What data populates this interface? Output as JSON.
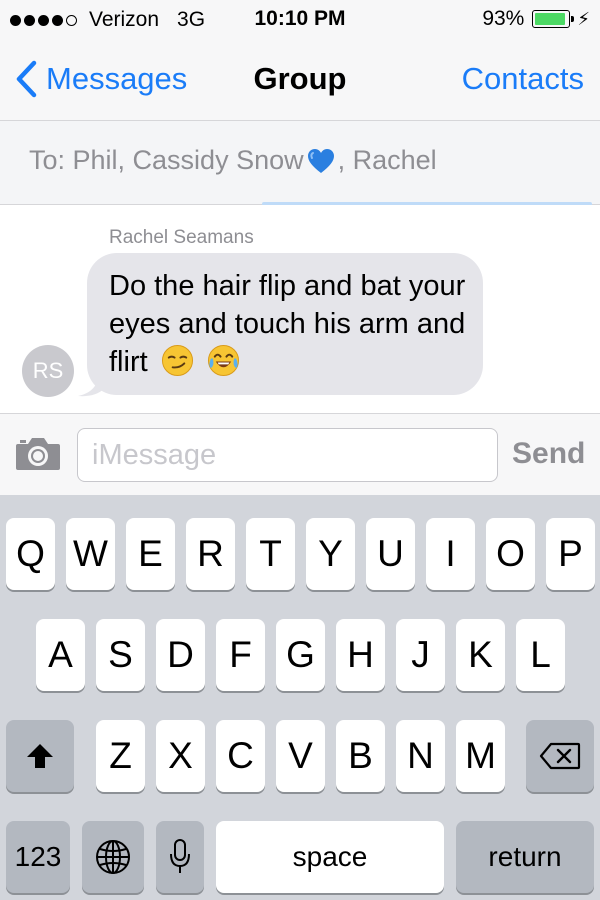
{
  "status_bar": {
    "carrier": "Verizon",
    "network": "3G",
    "time": "10:10 PM",
    "battery_percent": "93%",
    "battery_level": 0.93,
    "signal_bars_filled": 4,
    "signal_bars_total": 5
  },
  "nav": {
    "back_label": "Messages",
    "title": "Group",
    "contacts_label": "Contacts"
  },
  "to_field": {
    "recipients_before_emoji": "To: Phil, Cassidy Snow",
    "recipients_after_emoji": ", Rachel",
    "emoji": "blue-heart-icon"
  },
  "conversation": {
    "messages": [
      {
        "sender": "Rachel Seamans",
        "avatar_initials": "RS",
        "text": "Do the hair flip and bat your eyes and touch his arm and flirt",
        "emojis": [
          "smirking-face-icon",
          "tears-of-joy-face-icon"
        ]
      }
    ]
  },
  "input_bar": {
    "placeholder": "iMessage",
    "send_label": "Send"
  },
  "keyboard": {
    "row1": [
      "Q",
      "W",
      "E",
      "R",
      "T",
      "Y",
      "U",
      "I",
      "O",
      "P"
    ],
    "row2": [
      "A",
      "S",
      "D",
      "F",
      "G",
      "H",
      "J",
      "K",
      "L"
    ],
    "row3": [
      "Z",
      "X",
      "C",
      "V",
      "B",
      "N",
      "M"
    ],
    "numbers_label": "123",
    "space_label": "space",
    "return_label": "return"
  },
  "colors": {
    "ios_blue": "#1a7cf8",
    "battery_green": "#4cd964",
    "bubble_gray": "#e5e5ea",
    "keyboard_bg": "#d2d5db"
  }
}
